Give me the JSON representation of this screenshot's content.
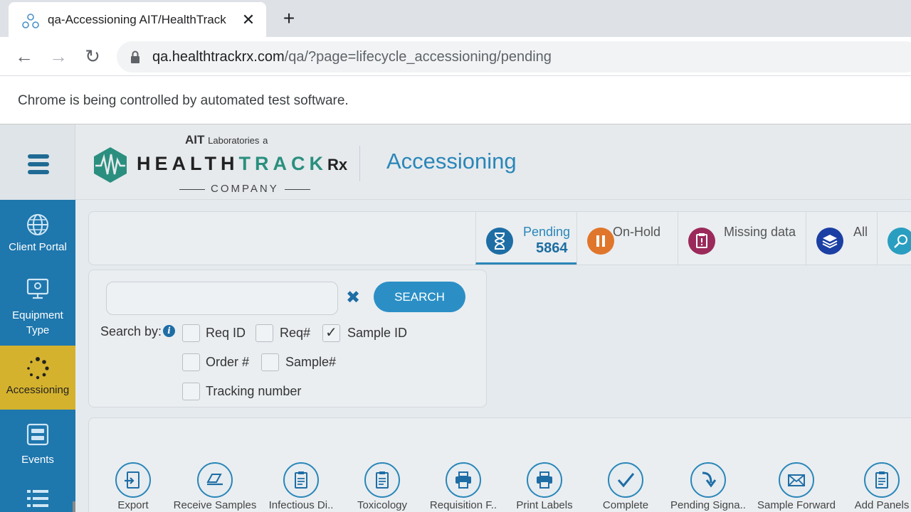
{
  "browser": {
    "tab_title": "qa-Accessioning AIT/HealthTrack",
    "url_host": "qa.healthtrackrx.com",
    "url_path": "/qa/?page=lifecycle_accessioning/pending",
    "infobar": "Chrome is being controlled by automated test software."
  },
  "header": {
    "logo_ait": "AIT",
    "logo_lab": "Laboratories",
    "logo_a": "a",
    "logo_health": "HEALTH",
    "logo_track": "TRACK",
    "logo_rx": "Rx",
    "logo_company": "COMPANY",
    "page_title": "Accessioning"
  },
  "sidebar": {
    "items": [
      {
        "label": "Client Portal"
      },
      {
        "label": "Equipment Type"
      },
      {
        "label": "Accessioning"
      },
      {
        "label": "Events"
      }
    ]
  },
  "status_tabs": [
    {
      "label": "Pending",
      "count": "5864",
      "color": "#1e6da5"
    },
    {
      "label": "On-Hold",
      "color": "#e0762b"
    },
    {
      "label": "Missing data",
      "color": "#9b2a5a"
    },
    {
      "label": "All",
      "color": "#1b3fa3"
    }
  ],
  "search": {
    "button": "SEARCH",
    "search_by": "Search by:",
    "options": [
      {
        "label": "Req ID",
        "checked": false
      },
      {
        "label": "Req#",
        "checked": false
      },
      {
        "label": "Sample ID",
        "checked": true
      },
      {
        "label": "Order #",
        "checked": false
      },
      {
        "label": "Sample#",
        "checked": false
      },
      {
        "label": "Tracking number",
        "checked": false
      }
    ]
  },
  "actions": [
    {
      "label": "Export"
    },
    {
      "label": "Receive Samples"
    },
    {
      "label": "Infectious Di.."
    },
    {
      "label": "Toxicology"
    },
    {
      "label": "Requisition F.."
    },
    {
      "label": "Print Labels"
    },
    {
      "label": "Complete"
    },
    {
      "label": "Pending Signa.."
    },
    {
      "label": "Sample Forward"
    },
    {
      "label": "Add Panels"
    }
  ]
}
